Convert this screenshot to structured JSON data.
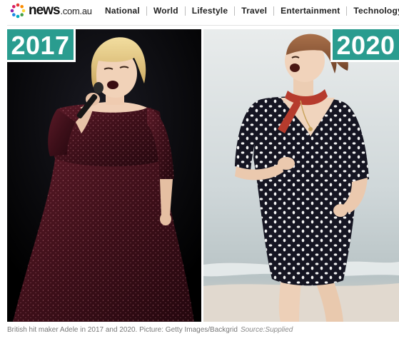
{
  "header": {
    "logo_word": "news",
    "logo_domain": ".com.au",
    "nav": [
      "National",
      "World",
      "Lifestyle",
      "Travel",
      "Entertainment",
      "Technology"
    ]
  },
  "photos": {
    "left_year": "2017",
    "right_year": "2020"
  },
  "caption": {
    "text": "British hit maker Adele in 2017 and 2020. Picture: Getty Images/Backgrid",
    "source": "Source:Supplied"
  },
  "colors": {
    "badge": "#2a9c8f",
    "dress_2017": "#4a1420",
    "dress_2020": "#141420"
  }
}
